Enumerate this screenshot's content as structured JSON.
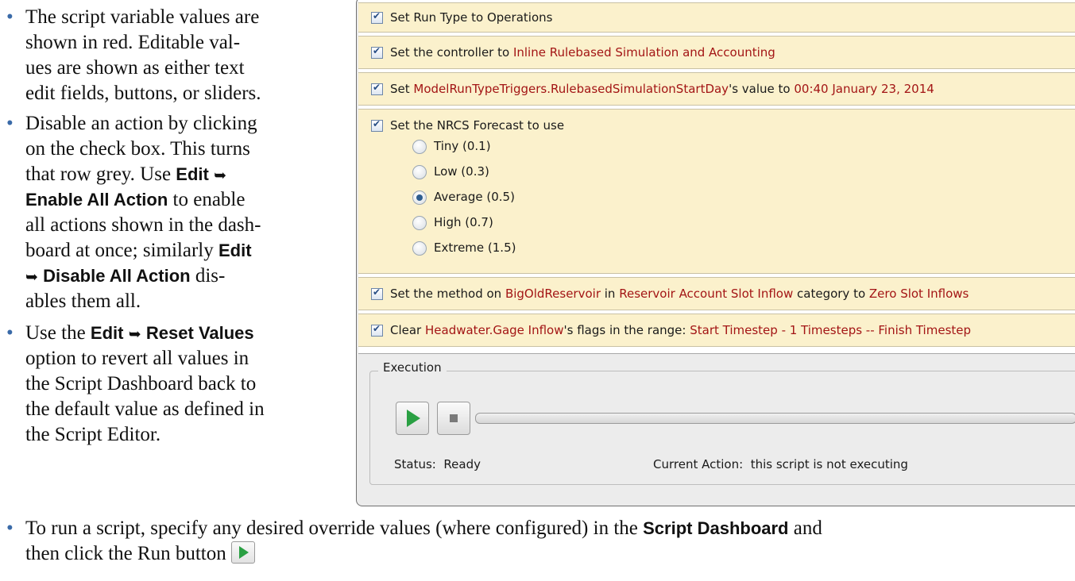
{
  "left_bullets": {
    "b1": {
      "line1": "The script variable values are",
      "line2": "shown in red. Editable val-",
      "line3": "ues are shown as either text",
      "line4": "edit fields, buttons, or sliders."
    },
    "b2": {
      "line1": "Disable an action by clicking",
      "line2": "on the check box. This turns",
      "line3_pre": "that row grey. Use ",
      "line3_kw": "Edit",
      "line4_kw": "Enable All Action",
      "line4_post": " to enable",
      "line5": "all actions shown in the dash-",
      "line6_pre": "board at once; similarly ",
      "line6_kw": "Edit",
      "line7_kw": "Disable All Action",
      "line7_post": " dis-",
      "line8": "ables them all."
    },
    "b3": {
      "line1_pre": "Use the ",
      "line1_kw1": "Edit",
      "line1_kw2": "Reset Values",
      "line2": "option to revert all values in",
      "line3": "the Script Dashboard back to",
      "line4": "the default value as defined in",
      "line5": "the Script Editor."
    },
    "arrow": "➥"
  },
  "dashboard": {
    "rows": [
      {
        "plain": [
          "Set Run Type to Operations"
        ]
      },
      {
        "plain": [
          "Set the controller to "
        ],
        "red": [
          "Inline Rulebased Simulation and Accounting"
        ]
      },
      {
        "plain": [
          "Set ",
          "'s value to "
        ],
        "red": [
          "ModelRunTypeTriggers.RulebasedSimulationStartDay",
          "00:40 January 23, 2014"
        ]
      },
      {
        "plain": [
          "Set the NRCS Forecast to use"
        ]
      },
      {
        "plain": [
          "Set the method on ",
          " in ",
          " category to "
        ],
        "red": [
          "BigOldReservoir",
          "Reservoir Account Slot Inflow",
          "Zero Slot Inflows"
        ]
      },
      {
        "plain": [
          "Clear ",
          "'s flags in the range: "
        ],
        "red": [
          "Headwater.Gage Inflow",
          "Start Timestep - 1 Timesteps -- Finish Timestep"
        ]
      }
    ],
    "forecast_options": [
      "Tiny (0.1)",
      "Low (0.3)",
      "Average (0.5)",
      "High (0.7)",
      "Extreme (1.5)"
    ],
    "forecast_selected": "Average (0.5)"
  },
  "execution": {
    "title": "Execution",
    "status_label": "Status:",
    "status_value": "Ready",
    "current_action_label": "Current Action:",
    "current_action_value": "this script is not executing",
    "progress": 0
  },
  "bottom_bullet": {
    "pre": "To run a script, specify any desired override values (where configured) in the ",
    "kw": "Script Dashboard",
    "post": " and",
    "line2": "then click the Run button"
  }
}
